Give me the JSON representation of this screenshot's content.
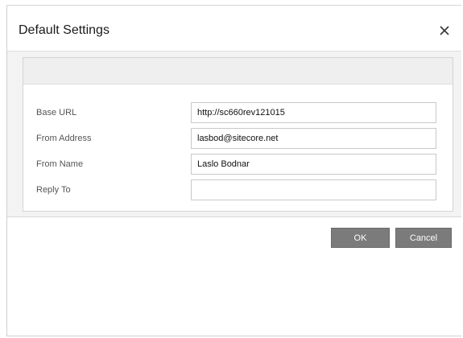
{
  "dialog": {
    "title": "Default Settings",
    "close_icon": "close-icon"
  },
  "fields": [
    {
      "label": "Base URL",
      "value": "http://sc660rev121015",
      "placeholder": ""
    },
    {
      "label": "From Address",
      "value": "lasbod@sitecore.net",
      "placeholder": ""
    },
    {
      "label": "From Name",
      "value": "Laslo Bodnar",
      "placeholder": ""
    },
    {
      "label": "Reply To",
      "value": "",
      "placeholder": ""
    }
  ],
  "buttons": {
    "ok_label": "OK",
    "cancel_label": "Cancel"
  },
  "colors": {
    "button_bg": "#7b7b7b",
    "panel_header_bg": "#efefef",
    "body_bg": "#f3f3f3"
  }
}
